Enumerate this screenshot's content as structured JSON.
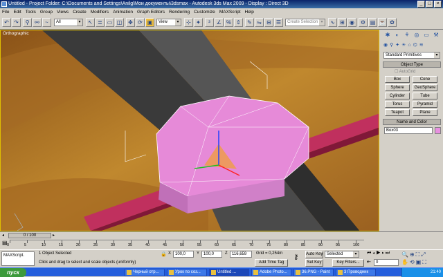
{
  "window": {
    "title": "Untitled     - Project Folder: C:\\Documents and Settings\\Anilg\\Мои документы\\3dsmax     - Autodesk 3ds Max  2009     - Display : Direct 3D",
    "minimize": "_",
    "maximize": "□",
    "close": "×"
  },
  "menu": [
    "File",
    "Edit",
    "Tools",
    "Group",
    "Views",
    "Create",
    "Modifiers",
    "Animation",
    "Graph Editors",
    "Rendering",
    "Customize",
    "MAXScript",
    "Help"
  ],
  "toolbar": {
    "selection_filter": "All",
    "ref_coord": "View",
    "named_selection_placeholder": "Create Selection Set"
  },
  "viewport": {
    "label": "Orthographic"
  },
  "command_panel": {
    "category_dropdown": "Standard Primitives",
    "object_type_header": "Object Type",
    "autogrid_label": "AutoGrid",
    "buttons": [
      "Box",
      "Cone",
      "Sphere",
      "GeoSphere",
      "Cylinder",
      "Tube",
      "Torus",
      "Pyramid",
      "Teapot",
      "Plane"
    ],
    "name_color_header": "Name and Color",
    "object_name": "Box03",
    "object_color": "#e890e0"
  },
  "timeline": {
    "frame_slider": "0 / 100",
    "ticks": [
      "0",
      "5",
      "10",
      "15",
      "20",
      "25",
      "30",
      "35",
      "40",
      "45",
      "50",
      "55",
      "60",
      "65",
      "70",
      "75",
      "80",
      "85",
      "90",
      "95",
      "100"
    ]
  },
  "status": {
    "maxscript": "MAXScript.",
    "selected": "1 Object Selected",
    "prompt": "Click and drag to select and scale objects (uniformly)",
    "x_label": "X",
    "x_value": "100,0",
    "y_label": "Y",
    "y_value": "100,0",
    "z_label": "Z",
    "z_value": "116,659",
    "grid": "Grid = 0,254m",
    "add_time_tag": "Add Time Tag",
    "auto_key": "Auto Key",
    "set_key": "Set Key",
    "key_mode": "Selected",
    "key_filters": "Key Filters...",
    "current_frame": "0"
  },
  "taskbar": {
    "start": "пуск",
    "tasks": [
      "Черный отр...",
      "Урок по соз...",
      "Untitled ...",
      "Adobe Photo...",
      "36.PNG - Paint",
      "3 Проводник"
    ],
    "clock": "21:40"
  },
  "colors": {
    "title_bar": "#0a246a",
    "viewport_bg": "#b07430",
    "selected_object": "#e890e0",
    "taskbar": "#245edc"
  }
}
